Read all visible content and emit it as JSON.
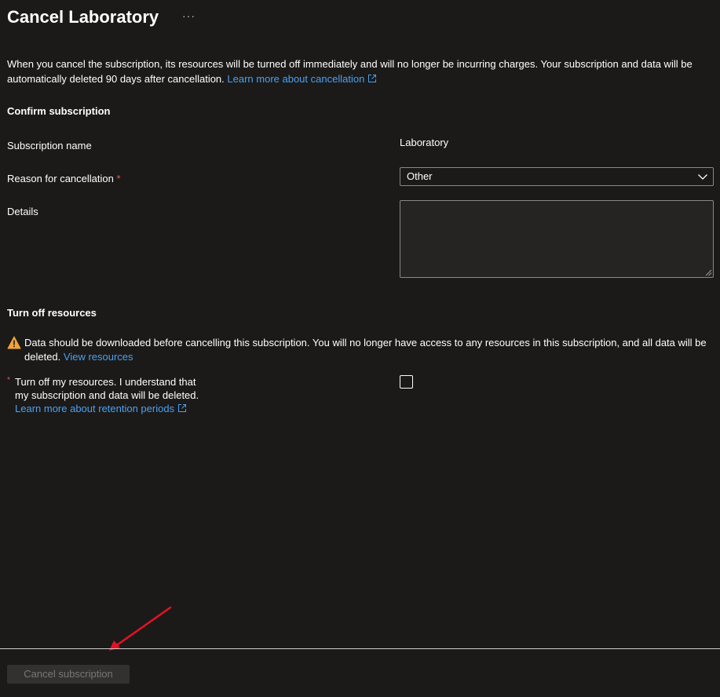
{
  "header": {
    "title": "Cancel Laboratory",
    "more_label": "···"
  },
  "intro": {
    "text": "When you cancel the subscription, its resources will be turned off immediately and will no longer be incurring charges. Your subscription and data will be automatically deleted 90 days after cancellation.",
    "link_text": "Learn more about cancellation"
  },
  "confirm": {
    "heading": "Confirm subscription",
    "subscription_name_label": "Subscription name",
    "subscription_name_value": "Laboratory",
    "reason_label": "Reason for cancellation",
    "required_marker": "*",
    "reason_value": "Other",
    "details_label": "Details",
    "details_value": ""
  },
  "resources": {
    "heading": "Turn off resources",
    "warning_text": "Data should be downloaded before cancelling this subscription. You will no longer have access to any resources in this subscription, and all data will be deleted.",
    "view_resources_link": "View resources",
    "ack_marker": "*",
    "ack_line1": "Turn off my resources. I understand that",
    "ack_line2": "my subscription and data will be deleted.",
    "retention_link": "Learn more about retention periods",
    "ack_checked": false
  },
  "footer": {
    "cancel_button_label": "Cancel subscription"
  },
  "colors": {
    "background": "#1b1a19",
    "link": "#4ba0ef",
    "required": "#e55b5b",
    "warning": "#f2a33a",
    "annotation_arrow": "#e81123",
    "disabled_button_bg": "#323130",
    "disabled_button_text": "#797775"
  },
  "icons": [
    "more-icon",
    "external-link-icon",
    "chevron-down-icon",
    "warning-icon",
    "resize-grip-icon",
    "annotation-arrow-icon"
  ]
}
